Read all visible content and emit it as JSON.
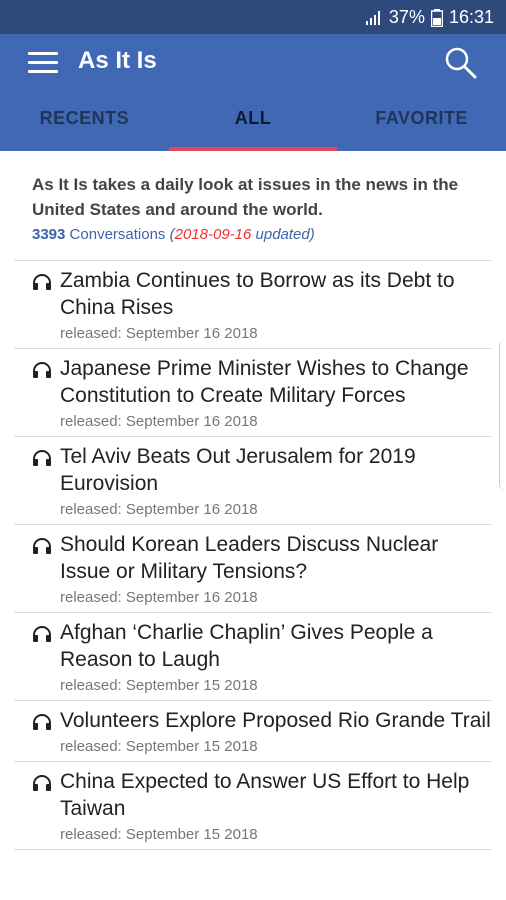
{
  "status": {
    "battery": "37%",
    "time": "16:31"
  },
  "header": {
    "title": "As It Is"
  },
  "tabs": [
    {
      "label": "RECENTS"
    },
    {
      "label": "ALL"
    },
    {
      "label": "FAVORITE"
    }
  ],
  "intro": {
    "description": "As It Is takes a daily look at issues in the news in the United States and around the world.",
    "count": "3393",
    "conversations_label": "Conversations",
    "open_paren": "(",
    "updated_date": "2018-09-16",
    "updated_label": " updated)"
  },
  "items": [
    {
      "title": "Zambia Continues to Borrow as its Debt to China Rises",
      "released": "released: September 16 2018"
    },
    {
      "title": "Japanese Prime Minister Wishes to Change Constitution to Create Military Forces",
      "released": "released: September 16 2018"
    },
    {
      "title": "Tel Aviv Beats Out Jerusalem for 2019 Eurovision",
      "released": "released: September 16 2018"
    },
    {
      "title": "Should Korean Leaders Discuss Nuclear Issue or Military Tensions?",
      "released": "released: September 16 2018"
    },
    {
      "title": "Afghan ‘Charlie Chaplin’ Gives People a Reason to Laugh",
      "released": "released: September 15 2018"
    },
    {
      "title": "Volunteers Explore Proposed Rio Grande Trail",
      "released": "released: September 15 2018"
    },
    {
      "title": "China Expected to Answer US Effort to Help Taiwan",
      "released": "released: September 15 2018"
    }
  ],
  "colors": {
    "primary": "#4068b5",
    "status_bar": "#2e4a7d",
    "indicator": "#e3495a",
    "date_red": "#ee3333",
    "link_blue": "#3f63a8"
  },
  "icons": [
    "menu-icon",
    "search-icon",
    "headphone-icon",
    "signal-icon",
    "battery-icon"
  ]
}
